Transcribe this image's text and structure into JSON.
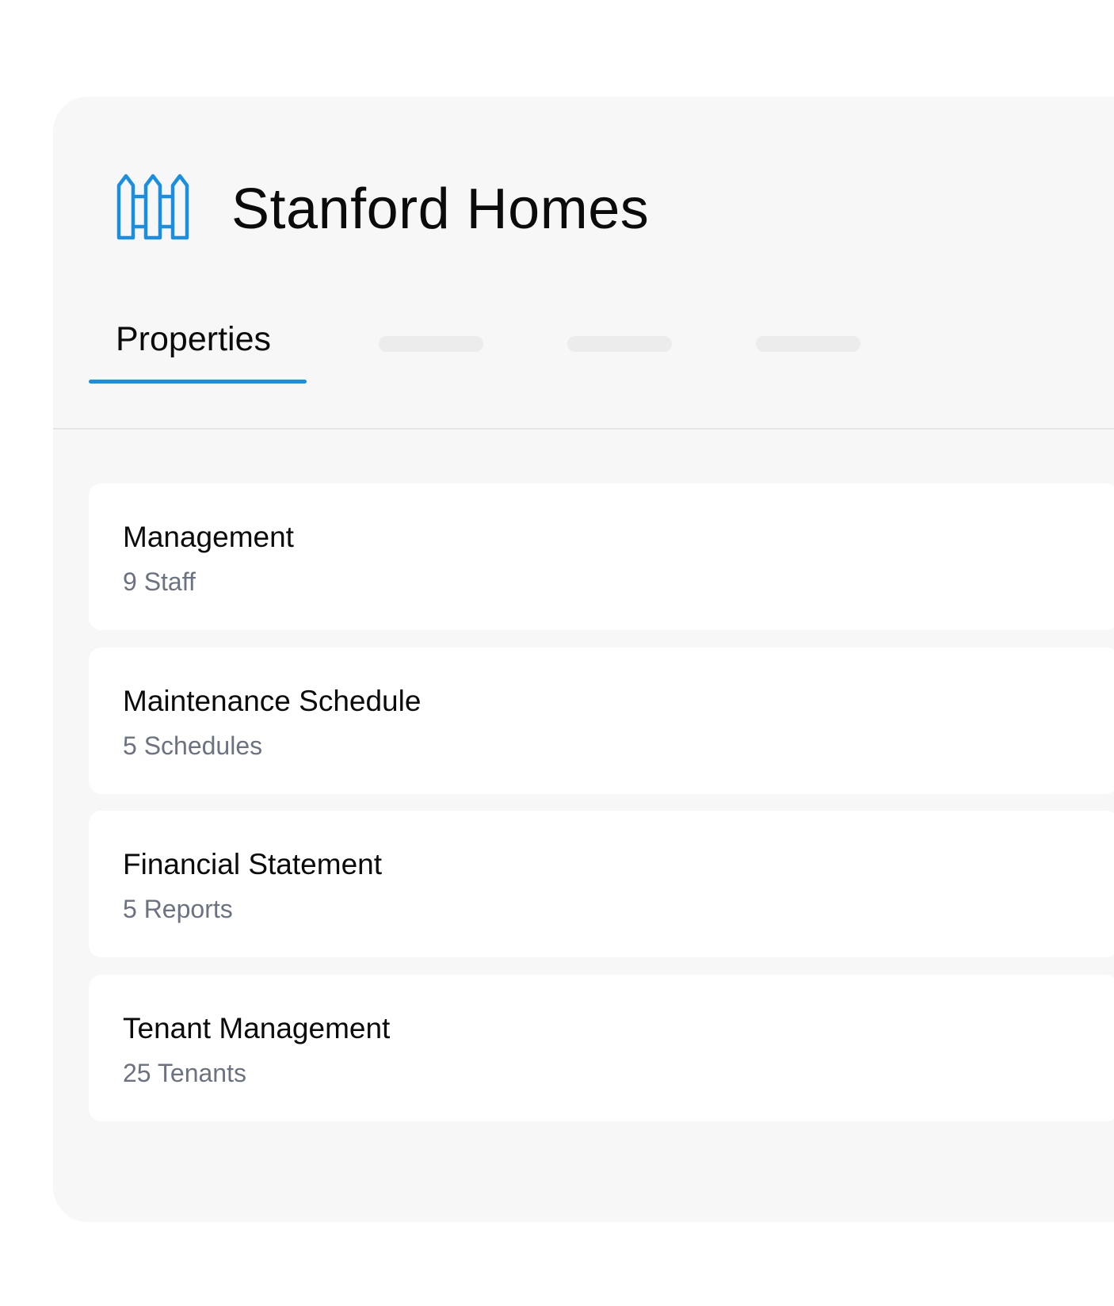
{
  "header": {
    "title": "Stanford Homes",
    "icon": "fence-icon",
    "accent_color": "#1a8fe0"
  },
  "tabs": {
    "active_label": "Properties",
    "placeholder_count_note": ""
  },
  "cards": [
    {
      "title": "Management",
      "subtitle": "9 Staff"
    },
    {
      "title": "Maintenance Schedule",
      "subtitle": "5 Schedules"
    },
    {
      "title": "Financial Statement",
      "subtitle": "5 Reports"
    },
    {
      "title": "Tenant Management",
      "subtitle": "25 Tenants"
    }
  ]
}
